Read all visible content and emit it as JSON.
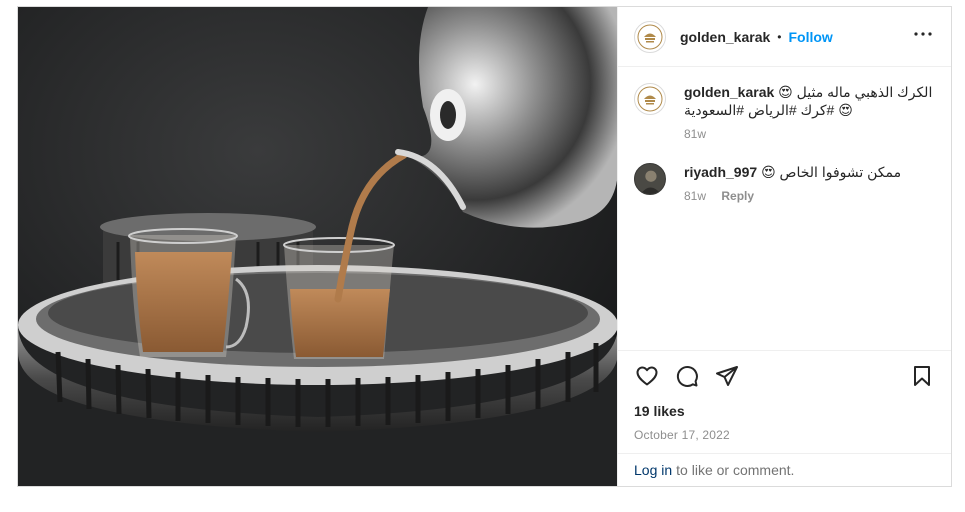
{
  "post": {
    "username": "golden_karak",
    "separator": "•",
    "follow_label": "Follow",
    "more_label": "•••"
  },
  "caption": {
    "username": "golden_karak",
    "text": "الكرك الذهبي ماله مثيل 😍😍 #كرك #الرياض #السعودية",
    "age": "81w"
  },
  "comments": [
    {
      "username": "riyadh_997",
      "text": "ممكن تشوفوا الخاص 😍",
      "age": "81w",
      "reply_label": "Reply"
    }
  ],
  "engagement": {
    "likes": "19 likes",
    "date": "October 17, 2022"
  },
  "footer": {
    "login_label": "Log in",
    "login_suffix": "to like or comment."
  },
  "icons": {
    "like": "heart-icon",
    "comment": "comment-bubble-icon",
    "share": "paper-plane-icon",
    "save": "bookmark-icon",
    "more": "more-options-icon"
  },
  "colors": {
    "accent": "#0095f6",
    "link": "#00376b",
    "muted": "#8e8e8e",
    "text": "#262626"
  }
}
